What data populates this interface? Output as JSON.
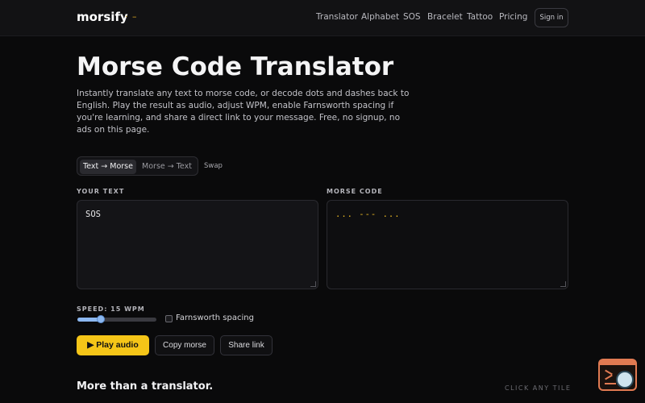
{
  "header": {
    "logo": "morsify",
    "logo_mark": "· –",
    "nav": [
      "Translator",
      "Alphabet",
      "SOS",
      "Bracelet",
      "Tattoo",
      "Pricing"
    ],
    "sign_in": "Sign in"
  },
  "main": {
    "title": "Morse Code Translator",
    "intro": "Instantly translate any text to morse code, or decode dots and dashes back to English. Play the result as audio, adjust WPM, enable Farnsworth spacing if you're learning, and share a direct link to your message. Free, no signup, no ads on this page.",
    "modes": [
      "Text → Morse",
      "Morse → Text"
    ],
    "active_mode": "Text → Morse",
    "swap": "Swap",
    "input_label": "YOUR TEXT",
    "input_value": "SOS",
    "output_label": "MORSE CODE",
    "output_value": "... --- ...",
    "speed_label": "SPEED: 15 WPM",
    "speed_fraction": 0.3,
    "farnsworth_label": "Farnsworth spacing",
    "farnsworth_checked": false,
    "play_label": "▶ Play audio",
    "copy_label": "Copy morse",
    "share_label": "Share link",
    "section_title": "More than a translator.",
    "section_hint": "CLICK ANY TILE"
  },
  "colors": {
    "accent": "#f5c518",
    "morse_text": "#e9b824",
    "slider": "#8cb8f0",
    "background": "#0a0a0b"
  },
  "icons": {
    "widget": "terminal-search-icon"
  }
}
